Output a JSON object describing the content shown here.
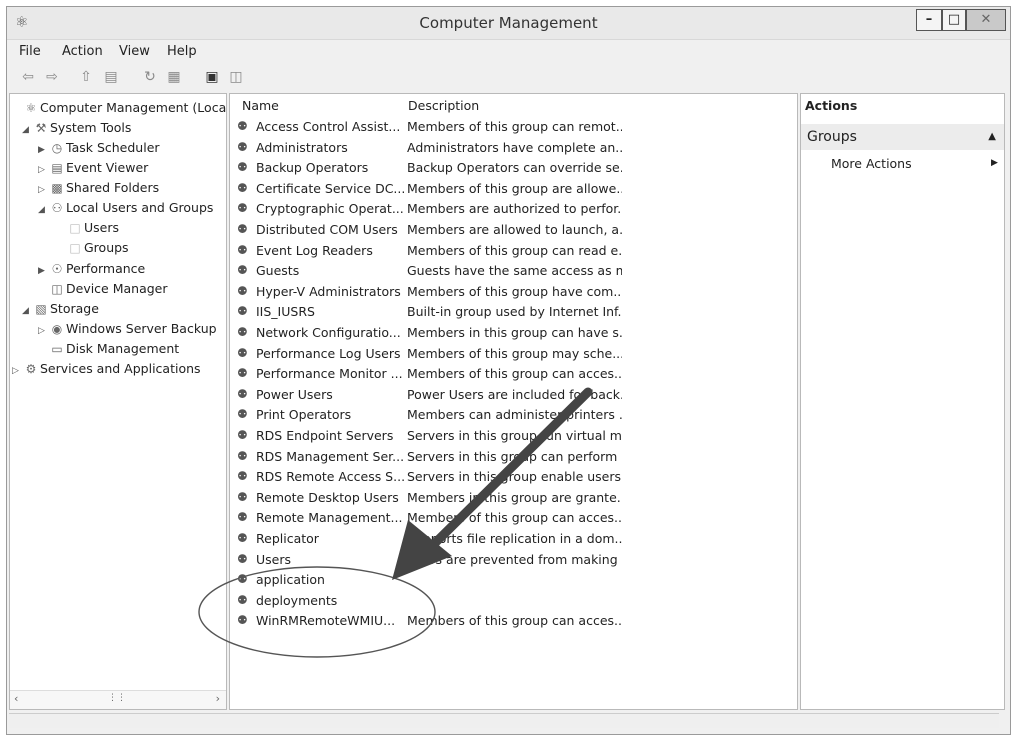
{
  "window": {
    "title": "Computer Management",
    "min_label": "–",
    "max_label": "□",
    "close_label": "✕"
  },
  "menu": [
    "File",
    "Action",
    "View",
    "Help"
  ],
  "toolbar_icons": [
    "back-icon",
    "forward-icon",
    "up-folder-icon",
    "show-hide-tree-icon",
    "refresh-icon",
    "export-list-icon",
    "properties-icon",
    "help-icon"
  ],
  "tree": [
    {
      "label": "Computer Management (Local",
      "level": 0,
      "expander": "",
      "icon": "computer-management-icon"
    },
    {
      "label": "System Tools",
      "level": 1,
      "expander": "◢",
      "icon": "system-tools-icon"
    },
    {
      "label": "Task Scheduler",
      "level": 2,
      "expander": "▶",
      "icon": "clock-icon"
    },
    {
      "label": "Event Viewer",
      "level": 2,
      "expander": "▷",
      "icon": "event-viewer-icon"
    },
    {
      "label": "Shared Folders",
      "level": 2,
      "expander": "▷",
      "icon": "shared-folders-icon"
    },
    {
      "label": "Local Users and Groups",
      "level": 2,
      "expander": "◢",
      "icon": "users-groups-icon"
    },
    {
      "label": "Users",
      "level": 3,
      "expander": "",
      "icon": "folder-icon"
    },
    {
      "label": "Groups",
      "level": 3,
      "expander": "",
      "icon": "folder-icon"
    },
    {
      "label": "Performance",
      "level": 2,
      "expander": "▶",
      "icon": "performance-icon"
    },
    {
      "label": "Device Manager",
      "level": 2,
      "expander": "",
      "icon": "device-manager-icon"
    },
    {
      "label": "Storage",
      "level": 1,
      "expander": "◢",
      "icon": "storage-icon"
    },
    {
      "label": "Windows Server Backup",
      "level": 2,
      "expander": "▷",
      "icon": "backup-icon"
    },
    {
      "label": "Disk Management",
      "level": 2,
      "expander": "",
      "icon": "disk-icon"
    },
    {
      "label": "Services and Applications",
      "level": 1,
      "expander": "▷",
      "icon": "services-icon"
    }
  ],
  "list": {
    "headers": {
      "name": "Name",
      "description": "Description"
    },
    "rows": [
      {
        "name": "Access Control Assist...",
        "description": "Members of this group can remot..."
      },
      {
        "name": "Administrators",
        "description": "Administrators have complete an..."
      },
      {
        "name": "Backup Operators",
        "description": "Backup Operators can override se..."
      },
      {
        "name": "Certificate Service DC...",
        "description": "Members of this group are allowe..."
      },
      {
        "name": "Cryptographic Operat...",
        "description": "Members are authorized to perfor..."
      },
      {
        "name": "Distributed COM Users",
        "description": "Members are allowed to launch, a..."
      },
      {
        "name": "Event Log Readers",
        "description": "Members of this group can read e..."
      },
      {
        "name": "Guests",
        "description": "Guests have the same access as m..."
      },
      {
        "name": "Hyper-V Administrators",
        "description": "Members of this group have com..."
      },
      {
        "name": "IIS_IUSRS",
        "description": "Built-in group used by Internet Inf..."
      },
      {
        "name": "Network Configuratio...",
        "description": "Members in this group can have s..."
      },
      {
        "name": "Performance Log Users",
        "description": "Members of this group may sche..."
      },
      {
        "name": "Performance Monitor ...",
        "description": "Members of this group can acces..."
      },
      {
        "name": "Power Users",
        "description": "Power Users are included for back..."
      },
      {
        "name": "Print Operators",
        "description": "Members can administer printers ..."
      },
      {
        "name": "RDS Endpoint Servers",
        "description": "Servers in this group run virtual m..."
      },
      {
        "name": "RDS Management Ser...",
        "description": "Servers in this group can perform ..."
      },
      {
        "name": "RDS Remote Access S...",
        "description": "Servers in this group enable users ..."
      },
      {
        "name": "Remote Desktop Users",
        "description": "Members in this group are grante..."
      },
      {
        "name": "Remote Management...",
        "description": "Members of this group can acces..."
      },
      {
        "name": "Replicator",
        "description": "Supports file replication in a dom..."
      },
      {
        "name": "Users",
        "description": "Users are prevented from making ..."
      },
      {
        "name": "application",
        "description": ""
      },
      {
        "name": "deployments",
        "description": ""
      },
      {
        "name": "WinRMRemoteWMIU...",
        "description": "Members of this group can acces..."
      }
    ]
  },
  "actions": {
    "header": "Actions",
    "group_title": "Groups",
    "more_actions": "More Actions"
  }
}
